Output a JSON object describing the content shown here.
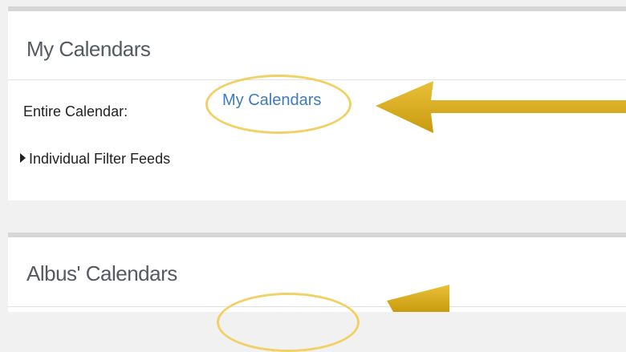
{
  "my_calendars_panel": {
    "title": "My Calendars",
    "entire_calendar_label": "Entire Calendar:",
    "entire_calendar_link": "My Calendars",
    "filter_feeds_toggle": "Individual Filter Feeds"
  },
  "albus_calendars_panel": {
    "title": "Albus' Calendars"
  },
  "colors": {
    "page_background": "#f1f1f2",
    "panel_top_border": "#d6d6d9",
    "link": "#3e7bbf",
    "highlight": "#f1d165",
    "arrow": "#d9ae16"
  },
  "icons": {
    "feeds_toggle": "caret-right-icon",
    "annotation": "arrow-left-icon"
  }
}
